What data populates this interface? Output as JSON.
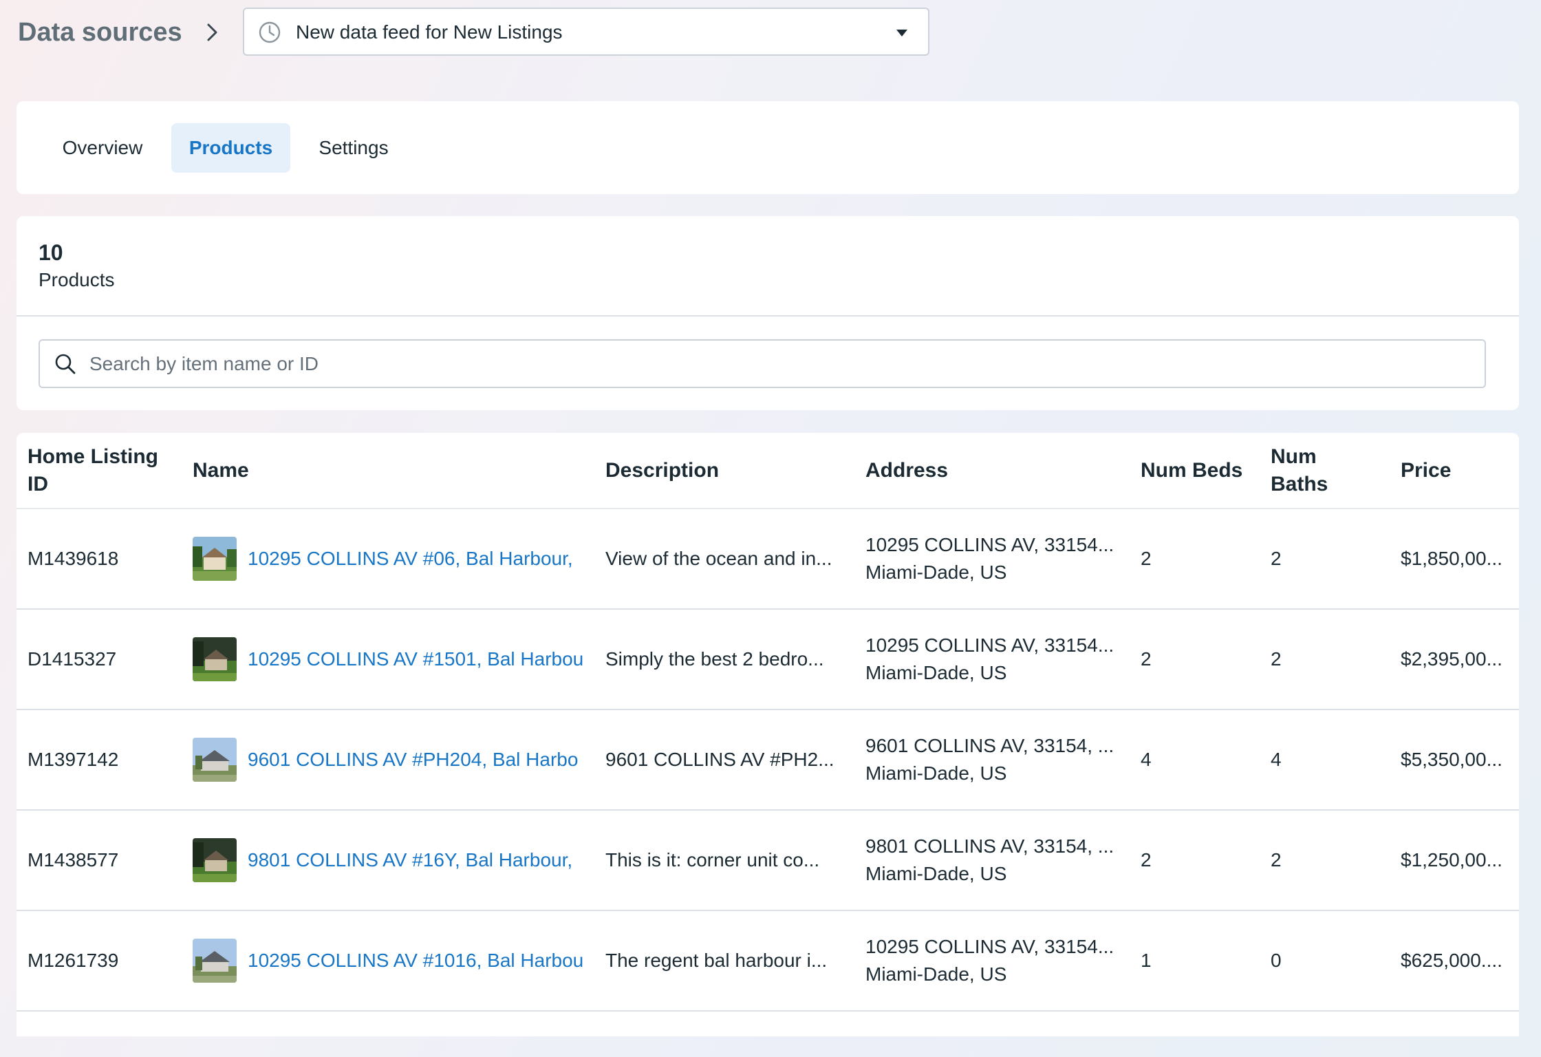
{
  "header": {
    "title": "Data sources",
    "feed_select": {
      "value": "New data feed for New Listings"
    }
  },
  "tabs": [
    {
      "label": "Overview",
      "active": false
    },
    {
      "label": "Products",
      "active": true
    },
    {
      "label": "Settings",
      "active": false
    }
  ],
  "summary": {
    "count": "10",
    "count_label": "Products"
  },
  "search": {
    "placeholder": "Search by item name or ID"
  },
  "table": {
    "headers": {
      "id": "Home Listing ID",
      "name": "Name",
      "description": "Description",
      "address": "Address",
      "beds": "Num Beds",
      "baths": "Num Baths",
      "price": "Price"
    },
    "rows": [
      {
        "id": "M1439618",
        "name": "10295 COLLINS AV #06, Bal Harbour,",
        "description": "View of the ocean and in...",
        "address_line1": "10295 COLLINS AV, 33154...",
        "address_line2": "Miami-Dade, US",
        "beds": "2",
        "baths": "2",
        "price": "$1,850,00...",
        "thumb_style": "sunny"
      },
      {
        "id": "D1415327",
        "name": "10295 COLLINS AV #1501, Bal Harbou",
        "description": "Simply the best 2 bedro...",
        "address_line1": "10295 COLLINS AV, 33154...",
        "address_line2": "Miami-Dade, US",
        "beds": "2",
        "baths": "2",
        "price": "$2,395,00...",
        "thumb_style": "dark"
      },
      {
        "id": "M1397142",
        "name": "9601 COLLINS AV #PH204, Bal Harbo",
        "description": "9601 COLLINS AV #PH2...",
        "address_line1": "9601 COLLINS AV, 33154, ...",
        "address_line2": "Miami-Dade, US",
        "beds": "4",
        "baths": "4",
        "price": "$5,350,00...",
        "thumb_style": "sky"
      },
      {
        "id": "M1438577",
        "name": "9801 COLLINS AV #16Y, Bal Harbour,",
        "description": "This is it: corner unit co...",
        "address_line1": "9801 COLLINS AV, 33154, ...",
        "address_line2": "Miami-Dade, US",
        "beds": "2",
        "baths": "2",
        "price": "$1,250,00...",
        "thumb_style": "dark"
      },
      {
        "id": "M1261739",
        "name": "10295 COLLINS AV #1016, Bal Harbou",
        "description": "The regent bal harbour i...",
        "address_line1": "10295 COLLINS AV, 33154...",
        "address_line2": "Miami-Dade, US",
        "beds": "1",
        "baths": "0",
        "price": "$625,000....",
        "thumb_style": "sky"
      }
    ]
  },
  "colors": {
    "link": "#1876c6",
    "active_tab_bg": "#e6f0fa",
    "text": "#1c2b33",
    "muted_title": "#5f6d77"
  }
}
